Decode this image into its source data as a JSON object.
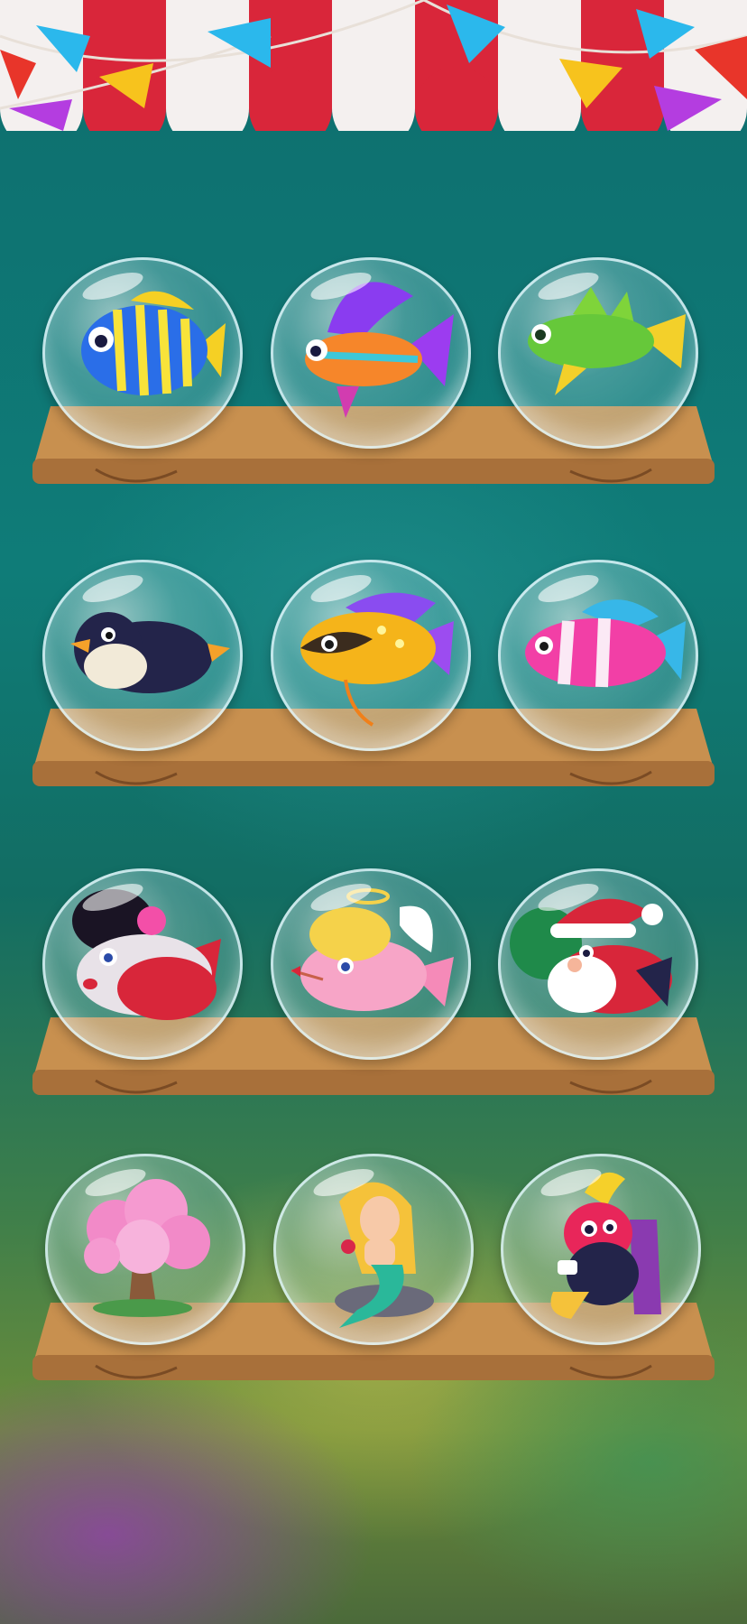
{
  "scene": "aquarium-collection-shelves",
  "colors": {
    "awning_red": "#d9263a",
    "awning_white": "#f4f0ef",
    "shelf_wood": "#c8904f",
    "background_teal": "#0f7c78"
  },
  "shelves": [
    {
      "items": [
        "striped-blue-fish",
        "orange-purple-fin-fish",
        "green-fin-fish"
      ]
    },
    {
      "items": [
        "penguin",
        "yellow-spotted-fish",
        "pink-clownfish"
      ]
    },
    {
      "items": [
        "geisha-fish",
        "cupid-fish",
        "santa-fish"
      ]
    },
    {
      "items": [
        "cherry-blossom-tree",
        "mermaid",
        "king-fish-on-throne"
      ]
    }
  ]
}
